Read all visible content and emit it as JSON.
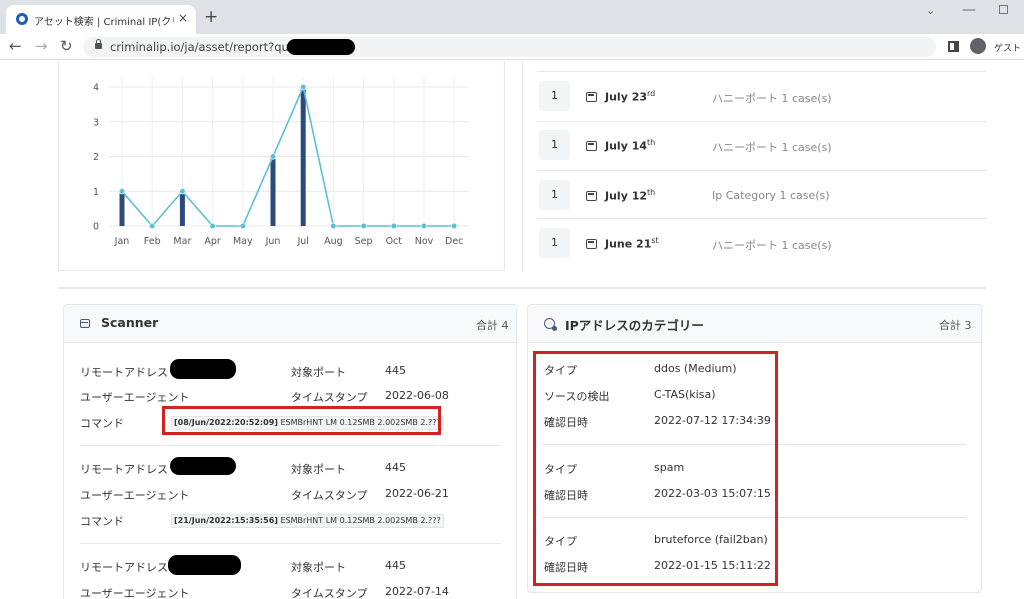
{
  "browser": {
    "tab_title": "アセット検索 | Criminal IP(クリミ",
    "tab_close": "×",
    "new_tab": "+",
    "url": "criminalip.io/ja/asset/report?query=",
    "profile_label": "ゲスト",
    "window_chevron": "⌄",
    "window_min": "—"
  },
  "chart_data": {
    "type": "line",
    "categories": [
      "Jan",
      "Feb",
      "Mar",
      "Apr",
      "May",
      "Jun",
      "Jul",
      "Aug",
      "Sep",
      "Oct",
      "Nov",
      "Dec"
    ],
    "values": [
      1,
      0,
      1,
      0,
      0,
      2,
      4,
      0,
      0,
      0,
      0,
      0
    ],
    "yticks": [
      "0",
      "1",
      "2",
      "3",
      "4"
    ],
    "ylim": [
      0,
      4
    ],
    "grid": true,
    "colors": {
      "line": "#5bc0d6",
      "bar": "#2c4a7c"
    }
  },
  "history": [
    {
      "count": "1",
      "date": "July 23",
      "suffix": "rd",
      "desc": "ハニーポート 1 case(s)"
    },
    {
      "count": "1",
      "date": "July 14",
      "suffix": "th",
      "desc": "ハニーポート 1 case(s)"
    },
    {
      "count": "1",
      "date": "July 12",
      "suffix": "th",
      "desc": "Ip Category 1 case(s)"
    },
    {
      "count": "1",
      "date": "June 21",
      "suffix": "st",
      "desc": "ハニーポート 1 case(s)"
    }
  ],
  "scanner": {
    "title": "Scanner",
    "total": "合計 4",
    "labels": {
      "remote": "リモートアドレス",
      "ua": "ユーザーエージェント",
      "command": "コマンド",
      "port": "対象ポート",
      "timestamp": "タイムスタンプ"
    },
    "entries": [
      {
        "port": "445",
        "timestamp": "2022-06-08",
        "cmd_time": "[08/Jun/2022:20:52:09]",
        "cmd_rest": " ESMBrHNT LM 0.12SMB 2.002SMB 2.???"
      },
      {
        "port": "445",
        "timestamp": "2022-06-21",
        "cmd_time": "[21/Jun/2022:15:35:56]",
        "cmd_rest": " ESMBrHNT LM 0.12SMB 2.002SMB 2.???"
      },
      {
        "port": "445",
        "timestamp": "2022-07-14"
      }
    ]
  },
  "category": {
    "title": "IPアドレスのカテゴリー",
    "total": "合計 3",
    "labels": {
      "type": "タイプ",
      "source": "ソースの検出",
      "confirmed": "確認日時"
    },
    "entries": [
      {
        "type": "ddos (Medium)",
        "source": "C-TAS(kisa)",
        "confirmed": "2022-07-12 17:34:39"
      },
      {
        "type": "spam",
        "confirmed": "2022-03-03 15:07:15"
      },
      {
        "type": "bruteforce (fail2ban)",
        "confirmed": "2022-01-15 15:11:22"
      }
    ]
  }
}
